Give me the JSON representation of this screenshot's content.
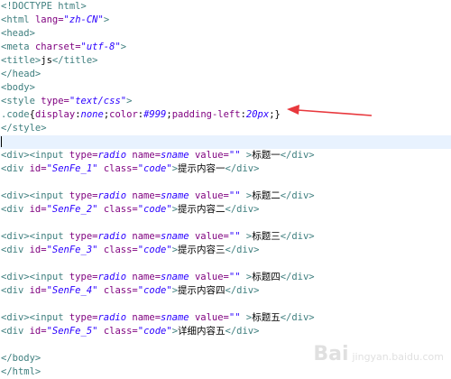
{
  "editor": {
    "lines": [
      {
        "tokens": [
          {
            "t": "tag",
            "s": "<!DOCTYPE html>"
          }
        ]
      },
      {
        "tokens": [
          {
            "t": "tag",
            "s": "<html "
          },
          {
            "t": "attr",
            "s": "lang="
          },
          {
            "t": "val",
            "s": "\"zh-CN\""
          },
          {
            "t": "tag",
            "s": ">"
          }
        ]
      },
      {
        "tokens": [
          {
            "t": "tag",
            "s": "<head>"
          }
        ]
      },
      {
        "tokens": [
          {
            "t": "tag",
            "s": "<meta "
          },
          {
            "t": "attr",
            "s": "charset="
          },
          {
            "t": "val",
            "s": "\"utf-8\""
          },
          {
            "t": "tag",
            "s": ">"
          }
        ]
      },
      {
        "tokens": [
          {
            "t": "tag",
            "s": "<title>"
          },
          {
            "t": "txt",
            "s": "js"
          },
          {
            "t": "tag",
            "s": "</title>"
          }
        ]
      },
      {
        "tokens": [
          {
            "t": "tag",
            "s": "</head>"
          }
        ]
      },
      {
        "tokens": [
          {
            "t": "tag",
            "s": "<body>"
          }
        ]
      },
      {
        "tokens": [
          {
            "t": "tag",
            "s": "<style "
          },
          {
            "t": "attr",
            "s": "type="
          },
          {
            "t": "val",
            "s": "\"text/css\""
          },
          {
            "t": "tag",
            "s": ">"
          }
        ]
      },
      {
        "tokens": [
          {
            "t": "css-sel",
            "s": ".code"
          },
          {
            "t": "punct",
            "s": "{"
          },
          {
            "t": "css-prop",
            "s": "display"
          },
          {
            "t": "punct",
            "s": ":"
          },
          {
            "t": "css-val",
            "s": "none"
          },
          {
            "t": "punct",
            "s": ";"
          },
          {
            "t": "css-prop",
            "s": "color"
          },
          {
            "t": "punct",
            "s": ":"
          },
          {
            "t": "css-val",
            "s": "#999"
          },
          {
            "t": "punct",
            "s": ";"
          },
          {
            "t": "css-prop",
            "s": "padding-left"
          },
          {
            "t": "punct",
            "s": ":"
          },
          {
            "t": "css-val",
            "s": "20px"
          },
          {
            "t": "punct",
            "s": ";}"
          }
        ]
      },
      {
        "tokens": [
          {
            "t": "tag",
            "s": "</style>"
          }
        ]
      },
      {
        "cursor": true,
        "tokens": []
      },
      {
        "tokens": [
          {
            "t": "tag",
            "s": "<div><input "
          },
          {
            "t": "attr",
            "s": "type="
          },
          {
            "t": "val",
            "s": "radio"
          },
          {
            "t": "txt",
            "s": " "
          },
          {
            "t": "attr",
            "s": "name="
          },
          {
            "t": "val",
            "s": "sname"
          },
          {
            "t": "txt",
            "s": " "
          },
          {
            "t": "attr",
            "s": "value="
          },
          {
            "t": "val",
            "s": "\"\""
          },
          {
            "t": "tag",
            "s": " >"
          },
          {
            "t": "txt",
            "s": "标题一"
          },
          {
            "t": "tag",
            "s": "</div>"
          }
        ]
      },
      {
        "tokens": [
          {
            "t": "tag",
            "s": "<div "
          },
          {
            "t": "attr",
            "s": "id="
          },
          {
            "t": "val",
            "s": "\"SenFe_1\""
          },
          {
            "t": "txt",
            "s": " "
          },
          {
            "t": "attr",
            "s": "class="
          },
          {
            "t": "val",
            "s": "\"code\""
          },
          {
            "t": "tag",
            "s": ">"
          },
          {
            "t": "txt",
            "s": "提示内容一"
          },
          {
            "t": "tag",
            "s": "</div>"
          }
        ]
      },
      {
        "tokens": []
      },
      {
        "tokens": [
          {
            "t": "tag",
            "s": "<div><input "
          },
          {
            "t": "attr",
            "s": "type="
          },
          {
            "t": "val",
            "s": "radio"
          },
          {
            "t": "txt",
            "s": " "
          },
          {
            "t": "attr",
            "s": "name="
          },
          {
            "t": "val",
            "s": "sname"
          },
          {
            "t": "txt",
            "s": " "
          },
          {
            "t": "attr",
            "s": "value="
          },
          {
            "t": "val",
            "s": "\"\""
          },
          {
            "t": "tag",
            "s": " >"
          },
          {
            "t": "txt",
            "s": "标题二"
          },
          {
            "t": "tag",
            "s": "</div>"
          }
        ]
      },
      {
        "tokens": [
          {
            "t": "tag",
            "s": "<div "
          },
          {
            "t": "attr",
            "s": "id="
          },
          {
            "t": "val",
            "s": "\"SenFe_2\""
          },
          {
            "t": "txt",
            "s": " "
          },
          {
            "t": "attr",
            "s": "class="
          },
          {
            "t": "val",
            "s": "\"code\""
          },
          {
            "t": "tag",
            "s": ">"
          },
          {
            "t": "txt",
            "s": "提示内容二"
          },
          {
            "t": "tag",
            "s": "</div>"
          }
        ]
      },
      {
        "tokens": []
      },
      {
        "tokens": [
          {
            "t": "tag",
            "s": "<div><input "
          },
          {
            "t": "attr",
            "s": "type="
          },
          {
            "t": "val",
            "s": "radio"
          },
          {
            "t": "txt",
            "s": " "
          },
          {
            "t": "attr",
            "s": "name="
          },
          {
            "t": "val",
            "s": "sname"
          },
          {
            "t": "txt",
            "s": " "
          },
          {
            "t": "attr",
            "s": "value="
          },
          {
            "t": "val",
            "s": "\"\""
          },
          {
            "t": "tag",
            "s": " >"
          },
          {
            "t": "txt",
            "s": "标题三"
          },
          {
            "t": "tag",
            "s": "</div>"
          }
        ]
      },
      {
        "tokens": [
          {
            "t": "tag",
            "s": "<div "
          },
          {
            "t": "attr",
            "s": "id="
          },
          {
            "t": "val",
            "s": "\"SenFe_3\""
          },
          {
            "t": "txt",
            "s": " "
          },
          {
            "t": "attr",
            "s": "class="
          },
          {
            "t": "val",
            "s": "\"code\""
          },
          {
            "t": "tag",
            "s": ">"
          },
          {
            "t": "txt",
            "s": "提示内容三"
          },
          {
            "t": "tag",
            "s": "</div>"
          }
        ]
      },
      {
        "tokens": []
      },
      {
        "tokens": [
          {
            "t": "tag",
            "s": "<div><input "
          },
          {
            "t": "attr",
            "s": "type="
          },
          {
            "t": "val",
            "s": "radio"
          },
          {
            "t": "txt",
            "s": " "
          },
          {
            "t": "attr",
            "s": "name="
          },
          {
            "t": "val",
            "s": "sname"
          },
          {
            "t": "txt",
            "s": " "
          },
          {
            "t": "attr",
            "s": "value="
          },
          {
            "t": "val",
            "s": "\"\""
          },
          {
            "t": "tag",
            "s": " >"
          },
          {
            "t": "txt",
            "s": "标题四"
          },
          {
            "t": "tag",
            "s": "</div>"
          }
        ]
      },
      {
        "tokens": [
          {
            "t": "tag",
            "s": "<div "
          },
          {
            "t": "attr",
            "s": "id="
          },
          {
            "t": "val",
            "s": "\"SenFe_4\""
          },
          {
            "t": "txt",
            "s": " "
          },
          {
            "t": "attr",
            "s": "class="
          },
          {
            "t": "val",
            "s": "\"code\""
          },
          {
            "t": "tag",
            "s": ">"
          },
          {
            "t": "txt",
            "s": "提示内容四"
          },
          {
            "t": "tag",
            "s": "</div>"
          }
        ]
      },
      {
        "tokens": []
      },
      {
        "tokens": [
          {
            "t": "tag",
            "s": "<div><input "
          },
          {
            "t": "attr",
            "s": "type="
          },
          {
            "t": "val",
            "s": "radio"
          },
          {
            "t": "txt",
            "s": " "
          },
          {
            "t": "attr",
            "s": "name="
          },
          {
            "t": "val",
            "s": "sname"
          },
          {
            "t": "txt",
            "s": " "
          },
          {
            "t": "attr",
            "s": "value="
          },
          {
            "t": "val",
            "s": "\"\""
          },
          {
            "t": "tag",
            "s": " >"
          },
          {
            "t": "txt",
            "s": "标题五"
          },
          {
            "t": "tag",
            "s": "</div>"
          }
        ]
      },
      {
        "tokens": [
          {
            "t": "tag",
            "s": "<div "
          },
          {
            "t": "attr",
            "s": "id="
          },
          {
            "t": "val",
            "s": "\"SenFe_5\""
          },
          {
            "t": "txt",
            "s": " "
          },
          {
            "t": "attr",
            "s": "class="
          },
          {
            "t": "val",
            "s": "\"code\""
          },
          {
            "t": "tag",
            "s": ">"
          },
          {
            "t": "txt",
            "s": "详细内容五"
          },
          {
            "t": "tag",
            "s": "</div>"
          }
        ]
      },
      {
        "tokens": []
      },
      {
        "tokens": [
          {
            "t": "tag",
            "s": "</body>"
          }
        ]
      },
      {
        "tokens": [
          {
            "t": "tag",
            "s": "</html>"
          }
        ]
      }
    ]
  },
  "annotation": {
    "color": "#e8383d"
  },
  "watermark": {
    "logo": "Bai",
    "text": "jingyan.baidu.com"
  }
}
